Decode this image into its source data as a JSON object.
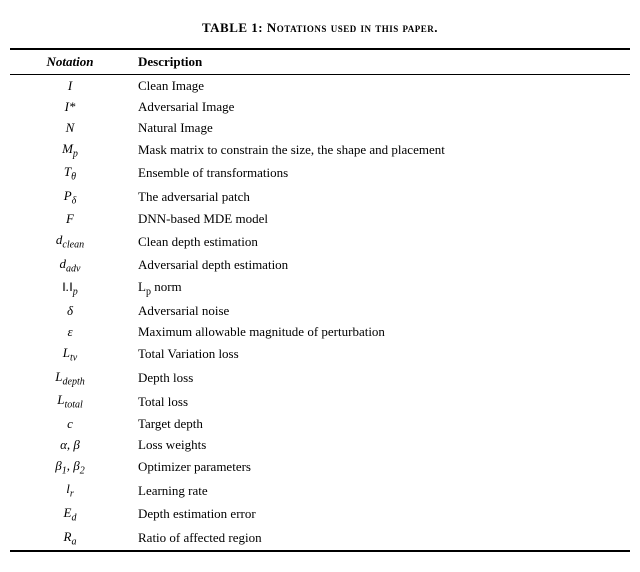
{
  "title": "TABLE 1: Notations used in this paper.",
  "columns": {
    "notation": "Notation",
    "description": "Description"
  },
  "rows": [
    {
      "notation_html": "I",
      "description": "Clean Image"
    },
    {
      "notation_html": "I*",
      "description": "Adversarial Image"
    },
    {
      "notation_html": "N",
      "description": "Natural Image"
    },
    {
      "notation_html": "M<sub>p</sub>",
      "description": "Mask matrix to constrain the size, the shape and placement"
    },
    {
      "notation_html": "T<sub>θ</sub>",
      "description": "Ensemble of transformations"
    },
    {
      "notation_html": "P<sub>δ</sub>",
      "description": "The adversarial patch"
    },
    {
      "notation_html": "F",
      "description": "DNN-based MDE model"
    },
    {
      "notation_html": "d<sub>clean</sub>",
      "description": "Clean depth estimation"
    },
    {
      "notation_html": "d<sub>adv</sub>",
      "description": "Adversarial depth estimation"
    },
    {
      "notation_html": "‖.‖<sub>p</sub>",
      "description": "L<sub>p</sub> norm"
    },
    {
      "notation_html": "δ",
      "description": "Adversarial noise"
    },
    {
      "notation_html": "ε",
      "description": "Maximum allowable magnitude of perturbation"
    },
    {
      "notation_html": "L<sub>tv</sub>",
      "description": "Total Variation loss"
    },
    {
      "notation_html": "L<sub>depth</sub>",
      "description": "Depth loss"
    },
    {
      "notation_html": "L<sub>total</sub>",
      "description": "Total loss"
    },
    {
      "notation_html": "c",
      "description": "Target depth"
    },
    {
      "notation_html": "α, β",
      "description": "Loss weights"
    },
    {
      "notation_html": "β<sub>1</sub>, β<sub>2</sub>",
      "description": "Optimizer parameters"
    },
    {
      "notation_html": "l<sub>r</sub>",
      "description": "Learning rate"
    },
    {
      "notation_html": "E<sub>d</sub>",
      "description": "Depth estimation error"
    },
    {
      "notation_html": "R<sub>a</sub>",
      "description": "Ratio of affected region"
    }
  ]
}
